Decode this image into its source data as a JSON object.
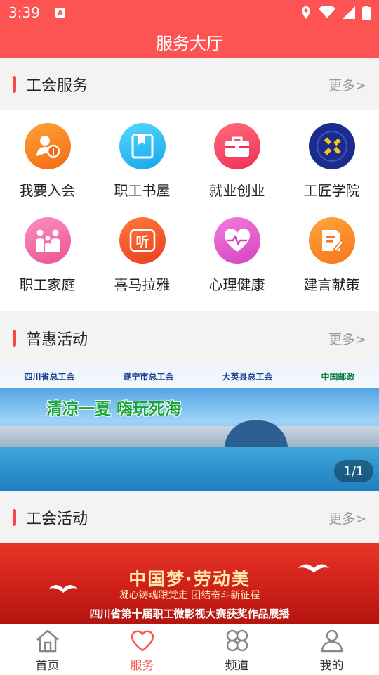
{
  "status": {
    "time": "3:39",
    "notify": "A"
  },
  "header": {
    "title": "服务大厅"
  },
  "sections": {
    "union_service": {
      "title": "工会服务",
      "more": "更多>"
    },
    "benefit": {
      "title": "普惠活动",
      "more": "更多>"
    },
    "union_activity": {
      "title": "工会活动",
      "more": "更多>"
    }
  },
  "services": [
    {
      "label": "我要入会",
      "icon": "membership-icon",
      "color": "#f97e1f"
    },
    {
      "label": "职工书屋",
      "icon": "book-icon",
      "color": "#2ec0f0"
    },
    {
      "label": "就业创业",
      "icon": "briefcase-icon",
      "color": "#f4476a"
    },
    {
      "label": "工匠学院",
      "icon": "craftsman-academy-logo-icon",
      "color": "#1c2c8c"
    },
    {
      "label": "职工家庭",
      "icon": "family-icon",
      "color": "#f06aa9"
    },
    {
      "label": "喜马拉雅",
      "icon": "ximalaya-icon",
      "color": "#f4582b"
    },
    {
      "label": "心理健康",
      "icon": "heart-pulse-icon",
      "color": "#e95fd0"
    },
    {
      "label": "建言献策",
      "icon": "suggestion-doc-icon",
      "color": "#f98b25"
    }
  ],
  "banner1": {
    "orgs": [
      "四川省总工会",
      "遂宁市总工会",
      "大英县总工会",
      "中国邮政"
    ],
    "headline": "清凉一夏 嗨玩死海",
    "counter": "1/1"
  },
  "banner2": {
    "headline": "中国梦·劳动美",
    "slogan": "凝心铸魂跟党走  团结奋斗新征程",
    "caption": "四川省第十届职工微影视大赛获奖作品展播"
  },
  "tabs": [
    {
      "label": "首页",
      "icon": "home-icon"
    },
    {
      "label": "服务",
      "icon": "heart-icon"
    },
    {
      "label": "频道",
      "icon": "channel-grid-icon"
    },
    {
      "label": "我的",
      "icon": "profile-icon"
    }
  ],
  "colors": {
    "brand": "#fd5353",
    "accent_bar": "#f44"
  }
}
